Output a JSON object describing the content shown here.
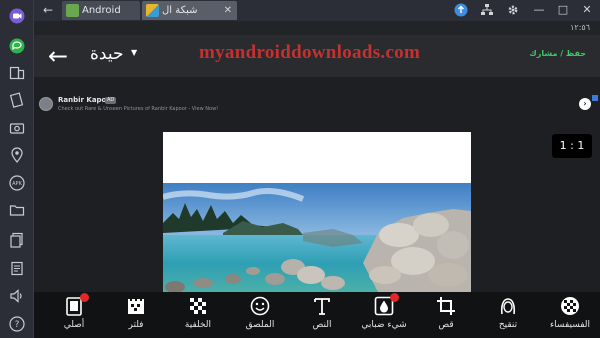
{
  "browser": {
    "tabs": [
      {
        "label": "Android",
        "icon": "android-icon"
      },
      {
        "label": "شبكة ال",
        "icon": "photo-grid-app-icon"
      }
    ]
  },
  "status_bar": {
    "time": "١٢:٥٦"
  },
  "app_bar": {
    "title": "حيدة",
    "watermark": "myandroiddownloads.com",
    "save_share_label": "حفظ / مشارك"
  },
  "ad": {
    "advertiser": "Ranbir Kapoor",
    "badge": "AD",
    "description": "Check out Rare & Unseen Pictures of Ranbir Kapoor - View Now!"
  },
  "aspect_ratio": {
    "label": "1 : 1"
  },
  "tools": [
    {
      "label": "الفسيفساء",
      "icon": "mosaic-icon",
      "badge": false
    },
    {
      "label": "تنقيح",
      "icon": "face-retouch-icon",
      "badge": false
    },
    {
      "label": "قص",
      "icon": "crop-icon",
      "badge": false
    },
    {
      "label": "شيء ضبابي",
      "icon": "blur-icon",
      "badge": true
    },
    {
      "label": "النص",
      "icon": "text-icon",
      "badge": false
    },
    {
      "label": "الملصق",
      "icon": "sticker-icon",
      "badge": false
    },
    {
      "label": "الخلفية",
      "icon": "background-icon",
      "badge": false
    },
    {
      "label": "فلتر",
      "icon": "filter-icon",
      "badge": false
    },
    {
      "label": "أصلي",
      "icon": "original-icon",
      "badge": true
    }
  ],
  "colors": {
    "accent_green": "#3ec86b",
    "watermark_red": "#c6302e",
    "badge_red": "#e02828",
    "emulator_chrome": "#2b2e36"
  }
}
